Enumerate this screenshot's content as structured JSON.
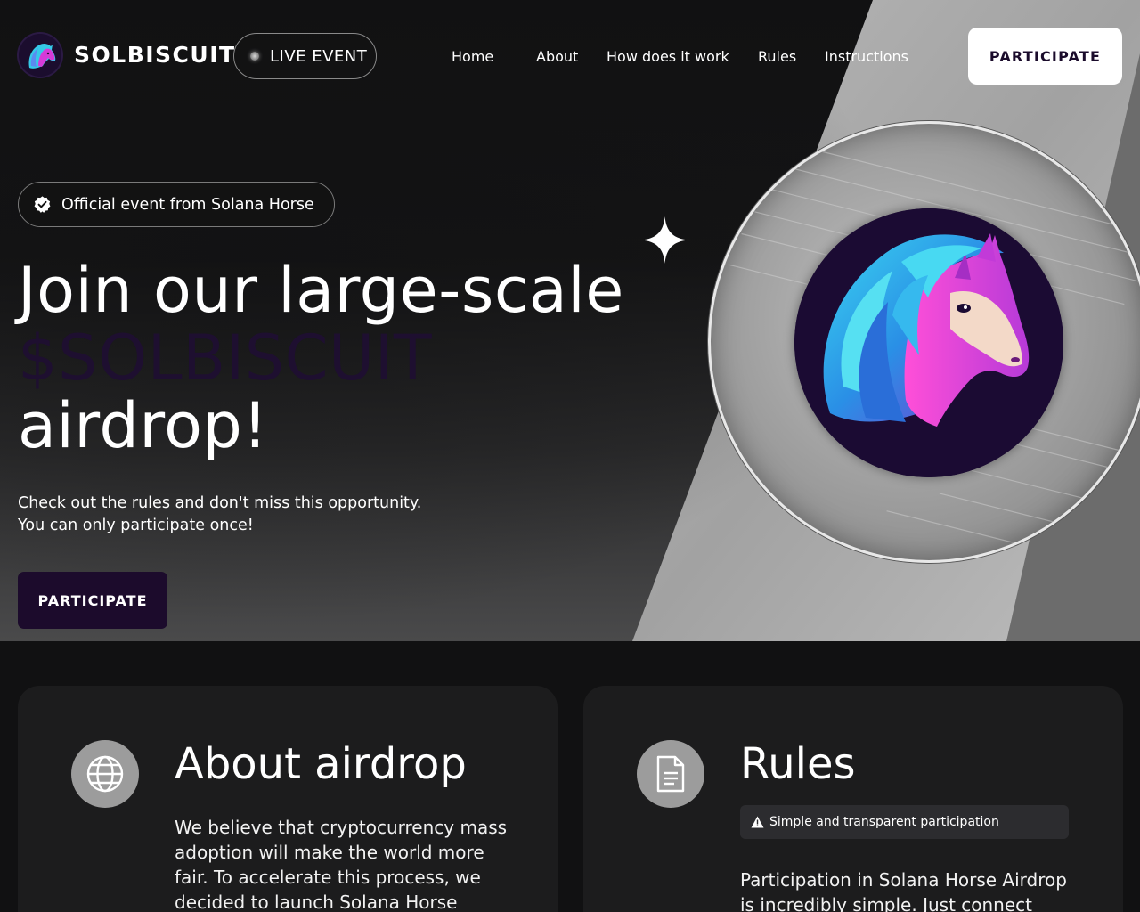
{
  "brand": {
    "name": "SOLBISCUIT",
    "live_label": "LIVE EVENT"
  },
  "nav": {
    "links": [
      "Home",
      "About",
      "How does it work",
      "Rules",
      "Instructions"
    ],
    "participate_label": "PARTICIPATE"
  },
  "hero": {
    "badge": "Official event from Solana Horse",
    "title_line1": "Join our large-scale",
    "title_accent": "$SOLBISCUIT",
    "title_line3": "airdrop!",
    "subtitle_line1": "Check out the rules and don't miss this opportunity.",
    "subtitle_line2": "You can only participate once!",
    "participate_label": "PARTICIPATE"
  },
  "cards": {
    "about": {
      "icon": "globe-icon",
      "title": "About airdrop",
      "text": "We believe that cryptocurrency mass adoption will make the world more fair. To accelerate this process, we decided to launch Solana Horse"
    },
    "rules": {
      "icon": "document-icon",
      "title": "Rules",
      "tag": "Simple and transparent participation",
      "text": "Participation in Solana Horse Airdrop is incredibly simple. Just connect"
    }
  },
  "colors": {
    "background": "#111112",
    "accent_purple": "#1c0b2c",
    "card_bg": "#1c1c1d",
    "icon_circle": "#9c9c9c"
  }
}
